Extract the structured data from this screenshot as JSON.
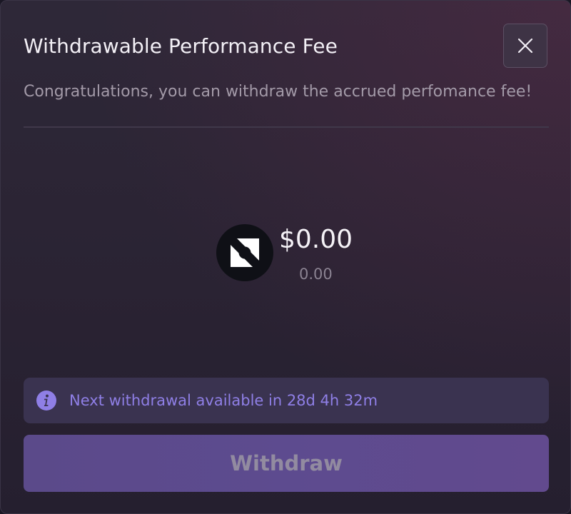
{
  "modal": {
    "title": "Withdrawable Performance Fee",
    "subtitle": "Congratulations, you can withdraw the accrued perfomance fee!",
    "close_icon": "close-icon"
  },
  "balance": {
    "token_icon": "token-logo-icon",
    "usd_value": "$0.00",
    "token_amount": "0.00"
  },
  "notice": {
    "icon": "info-icon",
    "text": "Next withdrawal available in 28d 4h 32m",
    "color": "#8f7fe6"
  },
  "actions": {
    "withdraw_label": "Withdraw",
    "withdraw_disabled": true
  },
  "colors": {
    "accent": "#5d4b8f",
    "banner_background": "#3a3350"
  }
}
